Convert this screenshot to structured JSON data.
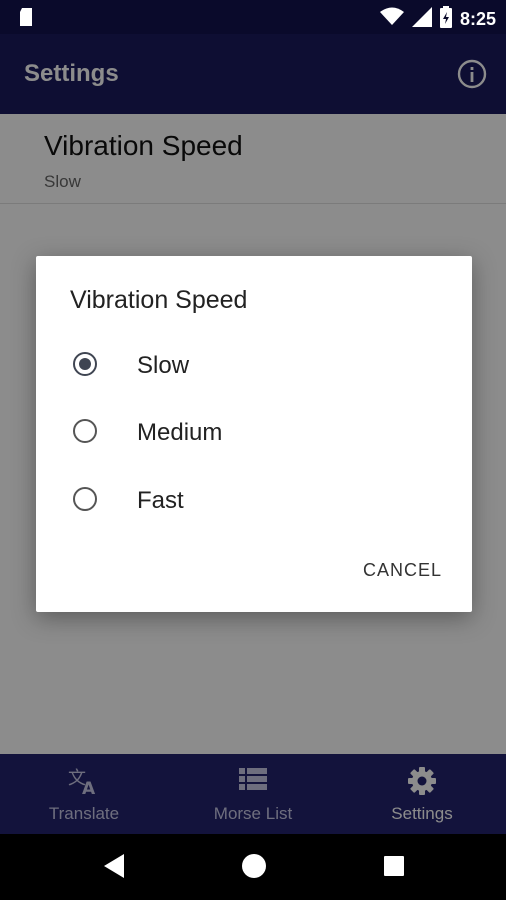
{
  "status_bar": {
    "time": "8:25"
  },
  "app_bar": {
    "title": "Settings"
  },
  "preference": {
    "title": "Vibration Speed",
    "summary": "Slow"
  },
  "dialog": {
    "title": "Vibration Speed",
    "options": [
      {
        "label": "Slow",
        "selected": true
      },
      {
        "label": "Medium",
        "selected": false
      },
      {
        "label": "Fast",
        "selected": false
      }
    ],
    "cancel_label": "CANCEL"
  },
  "bottom_nav": {
    "items": [
      {
        "label": "Translate",
        "icon": "translate-icon",
        "active": false
      },
      {
        "label": "Morse List",
        "icon": "list-icon",
        "active": false
      },
      {
        "label": "Settings",
        "icon": "gear-icon",
        "active": true
      }
    ]
  },
  "colors": {
    "app_bar": "#1a1a5e",
    "bottom_nav": "#24246e",
    "radio_selected": "#3f4552"
  }
}
